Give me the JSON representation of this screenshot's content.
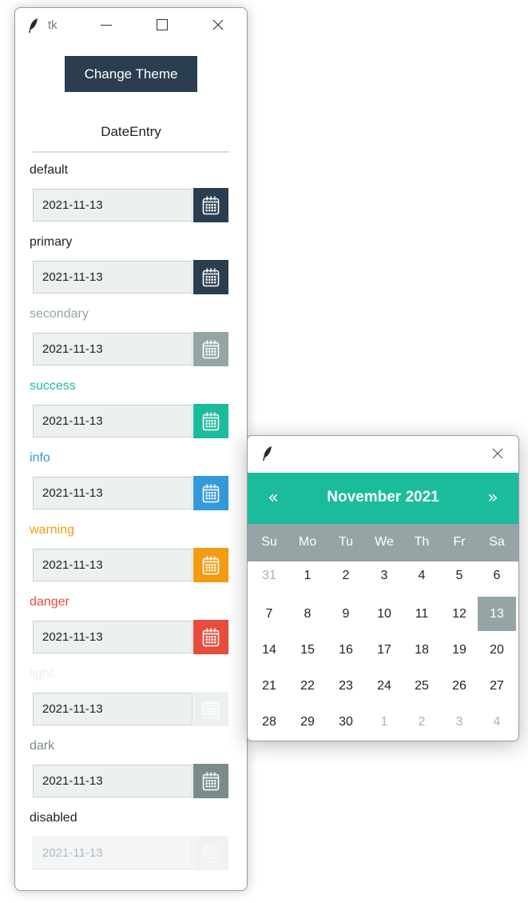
{
  "window": {
    "title": "tk"
  },
  "toolbar": {
    "change_theme_label": "Change Theme"
  },
  "section_title": "DateEntry",
  "entries": [
    {
      "label": "default",
      "value": "2021-11-13",
      "color": "#2b3e50",
      "label_color": "#222222"
    },
    {
      "label": "primary",
      "value": "2021-11-13",
      "color": "#2b3e50",
      "label_color": "#222222"
    },
    {
      "label": "secondary",
      "value": "2021-11-13",
      "color": "#95a5a6",
      "label_color": "#95a5a6"
    },
    {
      "label": "success",
      "value": "2021-11-13",
      "color": "#1abc9c",
      "label_color": "#1abc9c"
    },
    {
      "label": "info",
      "value": "2021-11-13",
      "color": "#3498db",
      "label_color": "#3498db"
    },
    {
      "label": "warning",
      "value": "2021-11-13",
      "color": "#f39c12",
      "label_color": "#f39c12"
    },
    {
      "label": "danger",
      "value": "2021-11-13",
      "color": "#e74c3c",
      "label_color": "#e74c3c"
    },
    {
      "label": "light",
      "value": "2021-11-13",
      "color": "#ecf0f1",
      "label_color": "#ecf0f1"
    },
    {
      "label": "dark",
      "value": "2021-11-13",
      "color": "#7b8a8b",
      "label_color": "#7b8a8b"
    },
    {
      "label": "disabled",
      "value": "2021-11-13",
      "color": "#f0f2f3",
      "label_color": "#222222",
      "disabled": true
    }
  ],
  "calendar": {
    "prev_label": "«",
    "next_label": "»",
    "month_title": "November 2021",
    "header_color": "#1abc9c",
    "weekday_bar_color": "#95a5a6",
    "weekdays": [
      "Su",
      "Mo",
      "Tu",
      "We",
      "Th",
      "Fr",
      "Sa"
    ],
    "selected_day": "13",
    "weeks": [
      [
        "31",
        "1",
        "2",
        "3",
        "4",
        "5",
        "6"
      ],
      [
        "7",
        "8",
        "9",
        "10",
        "11",
        "12",
        "13"
      ],
      [
        "14",
        "15",
        "16",
        "17",
        "18",
        "19",
        "20"
      ],
      [
        "21",
        "22",
        "23",
        "24",
        "25",
        "26",
        "27"
      ],
      [
        "28",
        "29",
        "30",
        "1",
        "2",
        "3",
        "4"
      ]
    ],
    "muted_days": [
      "31",
      "1*",
      "2*",
      "3*",
      "4*"
    ]
  }
}
